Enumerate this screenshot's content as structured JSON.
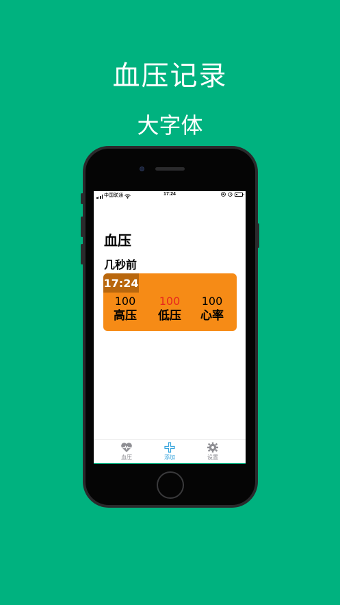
{
  "promo": {
    "title": "血压记录",
    "subtitle": "大字体"
  },
  "statusbar": {
    "carrier": "中国联通",
    "time": "17:24"
  },
  "screen": {
    "page_title": "血压",
    "section_title": "几秒前",
    "record": {
      "time": "17:24",
      "metrics": [
        {
          "value": "100",
          "label": "高压",
          "color": "#000000"
        },
        {
          "value": "100",
          "label": "低压",
          "color": "#e8281e"
        },
        {
          "value": "100",
          "label": "心率",
          "color": "#000000"
        }
      ],
      "card_color": "#f68b16"
    }
  },
  "tabbar": {
    "items": [
      {
        "label": "血压",
        "icon": "heart-pulse-icon",
        "active": false
      },
      {
        "label": "添加",
        "icon": "plus-icon",
        "active": true
      },
      {
        "label": "设置",
        "icon": "gear-icon",
        "active": false
      }
    ],
    "active_color": "#34a3dc",
    "inactive_color": "#8e8e93"
  }
}
